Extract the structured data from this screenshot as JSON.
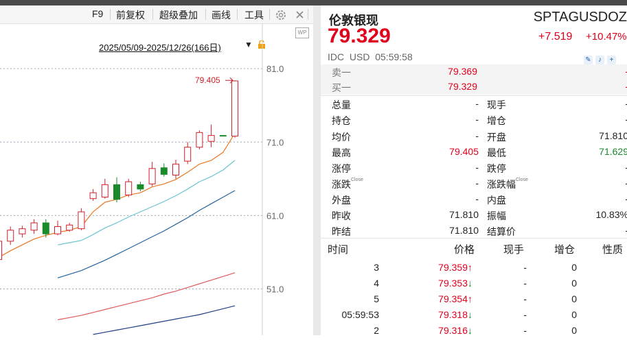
{
  "toolbar": {
    "items": [
      "F9",
      "前复权",
      "超级叠加",
      "画线",
      "工具"
    ],
    "more": "»"
  },
  "chart": {
    "range_label": "2025/05/09-2025/12/26(166日)",
    "high_label": "79.405",
    "y_ticks": [
      "81.0",
      "71.0",
      "61.0",
      "51.0"
    ]
  },
  "chart_data": {
    "type": "candlestick",
    "y_ticks": [
      81.0,
      71.0,
      61.0,
      51.0
    ],
    "ylim": [
      44.7,
      89.6
    ],
    "candles": [
      {
        "o": 55,
        "c": 57.5,
        "h": 58,
        "l": 54.5
      },
      {
        "o": 57.5,
        "c": 59,
        "h": 59.5,
        "l": 57
      },
      {
        "o": 58.5,
        "c": 59.2,
        "h": 59.6,
        "l": 58
      },
      {
        "o": 59,
        "c": 60,
        "h": 60.5,
        "l": 58.5
      },
      {
        "o": 60,
        "c": 58.5,
        "h": 60.5,
        "l": 58
      },
      {
        "o": 58.5,
        "c": 59.5,
        "h": 60.3,
        "l": 58.3
      },
      {
        "o": 59,
        "c": 59.7,
        "h": 60,
        "l": 58.8
      },
      {
        "o": 59.2,
        "c": 61.5,
        "h": 62,
        "l": 59
      },
      {
        "o": 63.3,
        "c": 64.1,
        "h": 64.6,
        "l": 63
      },
      {
        "o": 63.5,
        "c": 65.2,
        "h": 66,
        "l": 63.3
      },
      {
        "o": 65.2,
        "c": 63.2,
        "h": 66.2,
        "l": 62.8
      },
      {
        "o": 63.8,
        "c": 65.6,
        "h": 66,
        "l": 63.5
      },
      {
        "o": 65.2,
        "c": 64.6,
        "h": 65.6,
        "l": 64.3
      },
      {
        "o": 65.3,
        "c": 67.4,
        "h": 68.3,
        "l": 65
      },
      {
        "o": 67.5,
        "c": 66.6,
        "h": 68.1,
        "l": 66.3
      },
      {
        "o": 66.5,
        "c": 68,
        "h": 68.6,
        "l": 66
      },
      {
        "o": 68.4,
        "c": 70.3,
        "h": 71,
        "l": 68
      },
      {
        "o": 70.3,
        "c": 72.3,
        "h": 72.6,
        "l": 70
      },
      {
        "o": 71.1,
        "c": 71.9,
        "h": 73.4,
        "l": 70.3
      },
      {
        "o": 71.9,
        "c": 71.85,
        "h": 71.9,
        "l": 71.8
      },
      {
        "o": 71.81,
        "c": 79.329,
        "h": 79.405,
        "l": 71.6
      }
    ],
    "ma": [
      {
        "color": "#e87722",
        "values": [
          55.3,
          56.2,
          57.0,
          57.8,
          58.3,
          58.7,
          59.0,
          59.5,
          61.5,
          62.8,
          63.2,
          63.8,
          64.1,
          64.9,
          65.3,
          65.9,
          66.9,
          68.0,
          68.5,
          69.6,
          72.2
        ]
      },
      {
        "color": "#6ac4d0",
        "values": [
          null,
          null,
          null,
          null,
          null,
          57.0,
          57.3,
          57.6,
          58.4,
          59.3,
          60.0,
          60.8,
          61.5,
          62.2,
          62.9,
          63.7,
          64.6,
          65.6,
          66.3,
          67.2,
          68.5
        ]
      },
      {
        "color": "#23629c",
        "values": [
          null,
          null,
          null,
          null,
          null,
          52.5,
          53.0,
          53.5,
          54.2,
          54.9,
          55.7,
          56.5,
          57.3,
          58.1,
          58.9,
          59.8,
          60.7,
          61.7,
          62.6,
          63.5,
          64.4
        ]
      },
      {
        "color": "#e05a5a",
        "values": [
          null,
          null,
          null,
          null,
          null,
          46.8,
          47.1,
          47.4,
          47.8,
          48.2,
          48.6,
          49.0,
          49.4,
          49.8,
          50.3,
          50.7,
          51.2,
          51.7,
          52.2,
          52.7,
          53.2
        ]
      },
      {
        "color": "#1e3f80",
        "values": [
          null,
          null,
          null,
          null,
          null,
          null,
          null,
          null,
          44.8,
          45.1,
          45.4,
          45.7,
          46.0,
          46.3,
          46.6,
          46.9,
          47.2,
          47.5,
          47.9,
          48.3,
          48.7
        ]
      }
    ]
  },
  "quote": {
    "name": "伦敦银现",
    "code": "SPTAGUSDOZ",
    "price": "79.329",
    "change": "+7.519",
    "change_pct": "+10.47%",
    "meta": "IDC  USD  05:59:58",
    "sell1_label": "卖一",
    "sell1": "79.369",
    "sell1_vol": "-",
    "buy1_label": "买一",
    "buy1": "79.329",
    "buy1_vol": "-"
  },
  "stats": [
    {
      "l1": "总量",
      "v1": "-",
      "l2": "现手",
      "v2": "-"
    },
    {
      "l1": "持仓",
      "v1": "-",
      "l2": "增仓",
      "v2": "-"
    },
    {
      "l1": "均价",
      "v1": "-",
      "l2": "开盘",
      "v2": "71.810"
    },
    {
      "l1": "最高",
      "v1": "79.405",
      "l2": "最低",
      "v2": "71.629"
    },
    {
      "l1": "涨停",
      "v1": "-",
      "l2": "跌停",
      "v2": "-"
    },
    {
      "l1": "涨跌",
      "v1": "-",
      "l2": "涨跌幅",
      "v2": "-"
    },
    {
      "l1": "外盘",
      "v1": "-",
      "l2": "内盘",
      "v2": "-"
    },
    {
      "l1": "昨收",
      "v1": "71.810",
      "l2": "振幅",
      "v2": "10.83%"
    },
    {
      "l1": "昨结",
      "v1": "71.810",
      "l2": "结算价",
      "v2": "-"
    }
  ],
  "close_tag": "Close",
  "ticks_header": {
    "time": "时间",
    "price": "价格",
    "vol": "现手",
    "oi": "增仓",
    "nature": "性质"
  },
  "ticks": [
    {
      "time": "3",
      "price": "79.359",
      "dir": "up",
      "vol": "-",
      "oi": "0"
    },
    {
      "time": "4",
      "price": "79.353",
      "dir": "down",
      "vol": "-",
      "oi": "0"
    },
    {
      "time": "5",
      "price": "79.354",
      "dir": "up",
      "vol": "-",
      "oi": "0"
    },
    {
      "time": "05:59:53",
      "price": "79.318",
      "dir": "down",
      "vol": "-",
      "oi": "0"
    },
    {
      "time": "2",
      "price": "79.316",
      "dir": "down",
      "vol": "-",
      "oi": "0"
    }
  ]
}
